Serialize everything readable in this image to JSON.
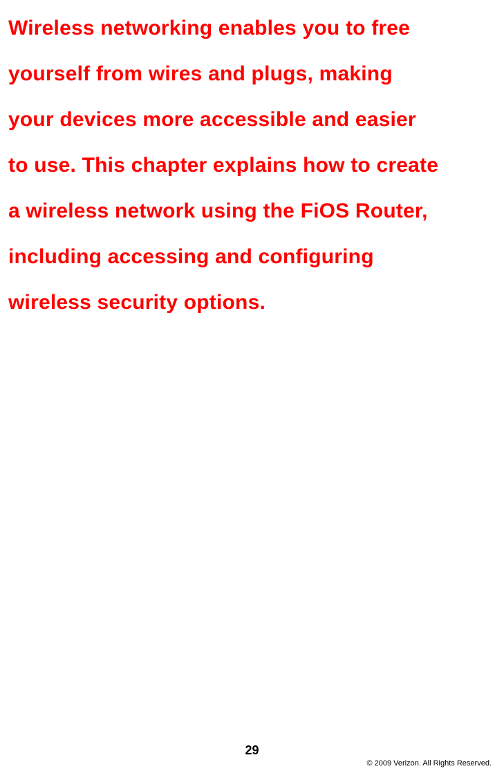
{
  "content": {
    "lines": [
      "Wireless networking enables you to free",
      "yourself from wires and plugs, making",
      "your devices more accessible and easier",
      "to use. This chapter explains how to create",
      "a wireless network using the FiOS Router,",
      "including accessing and configuring",
      "wireless security options."
    ]
  },
  "footer": {
    "page_number": "29",
    "copyright": "© 2009 Verizon. All Rights Reserved."
  }
}
